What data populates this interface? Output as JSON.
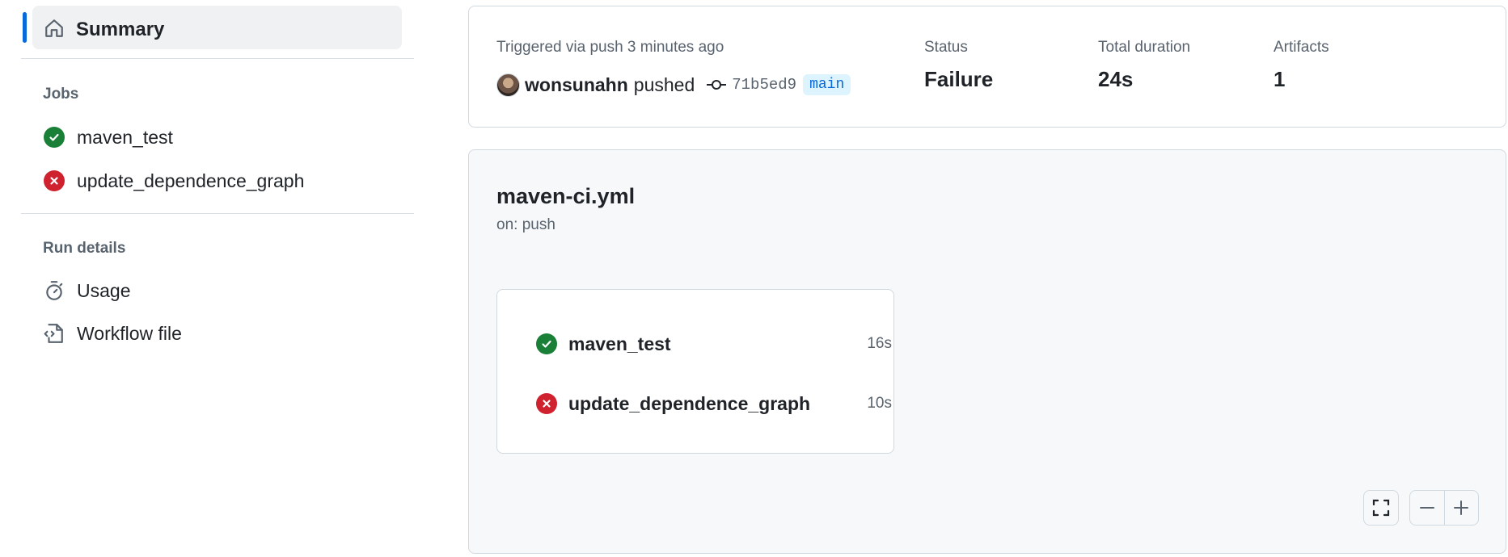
{
  "sidebar": {
    "summary_label": "Summary",
    "jobs_title": "Jobs",
    "jobs": [
      {
        "label": "maven_test",
        "status": "success"
      },
      {
        "label": "update_dependence_graph",
        "status": "failure"
      }
    ],
    "run_details_title": "Run details",
    "details": [
      {
        "label": "Usage",
        "icon": "stopwatch-icon"
      },
      {
        "label": "Workflow file",
        "icon": "file-code-icon"
      }
    ]
  },
  "run_info": {
    "trigger_text": "Triggered via push 3 minutes ago",
    "actor": "wonsunahn",
    "action": "pushed",
    "commit_sha": "71b5ed9",
    "branch": "main",
    "status_label": "Status",
    "status_value": "Failure",
    "duration_label": "Total duration",
    "duration_value": "24s",
    "artifacts_label": "Artifacts",
    "artifacts_value": "1"
  },
  "workflow": {
    "name": "maven-ci.yml",
    "trigger": "on: push",
    "jobs": [
      {
        "name": "maven_test",
        "duration": "16s",
        "status": "success"
      },
      {
        "name": "update_dependence_graph",
        "duration": "10s",
        "status": "failure"
      }
    ]
  },
  "colors": {
    "success": "#1a7f37",
    "failure": "#cf222e",
    "accent": "#0969da"
  }
}
